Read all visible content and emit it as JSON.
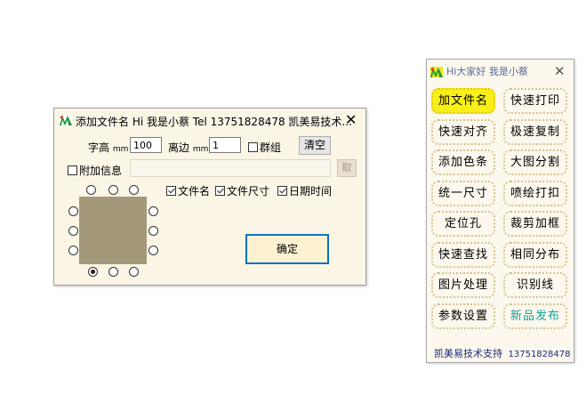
{
  "dialog": {
    "title": "添加文件名 Hi 我是小蔡 Tel 13751828478 凯美易技术...",
    "font_height_label": "字高",
    "font_height_unit": "mm",
    "font_height_value": "100",
    "margin_label": "离边",
    "margin_unit": "mm",
    "margin_value": "1",
    "group_checkbox_label": "群组",
    "group_checked": false,
    "clear_button": "清空",
    "extra_info_checkbox_label": "附加信息",
    "extra_info_checked": false,
    "extra_info_value": "",
    "fetch_button": "取",
    "filename_checkbox_label": "文件名",
    "filename_checked": true,
    "filesize_checkbox_label": "文件尺寸",
    "filesize_checked": true,
    "date_checkbox_label": "日期时间",
    "date_checked": true,
    "selected_position": "bottom-left",
    "ok_button": "确定"
  },
  "panel": {
    "title": "Hi大家好 我是小蔡",
    "buttons": [
      {
        "label": "加文件名",
        "style": "highlight"
      },
      {
        "label": "快速打印",
        "style": "normal"
      },
      {
        "label": "快速对齐",
        "style": "normal"
      },
      {
        "label": "极速复制",
        "style": "normal"
      },
      {
        "label": "添加色条",
        "style": "normal"
      },
      {
        "label": "大图分割",
        "style": "normal"
      },
      {
        "label": "统一尺寸",
        "style": "normal"
      },
      {
        "label": "喷绘打扣",
        "style": "normal"
      },
      {
        "label": "定位孔",
        "style": "normal"
      },
      {
        "label": "裁剪加框",
        "style": "normal"
      },
      {
        "label": "快速查找",
        "style": "normal"
      },
      {
        "label": "相同分布",
        "style": "normal"
      },
      {
        "label": "图片处理",
        "style": "normal"
      },
      {
        "label": "识别线",
        "style": "normal"
      },
      {
        "label": "参数设置",
        "style": "normal"
      },
      {
        "label": "新品发布",
        "style": "teal"
      }
    ],
    "footer_name": "凯美易技术支持",
    "footer_phone": "13751828478"
  },
  "colors": {
    "panel_bg": "#fcf8ed",
    "dialog_bg": "#fbf5e6",
    "highlight": "#f7ef17",
    "ok_border": "#0f6fc6",
    "preview_fill": "#a4987b",
    "accent_teal": "#15a19a"
  },
  "icons": {
    "app_logo": "km-logo-icon",
    "close": "close-icon"
  }
}
